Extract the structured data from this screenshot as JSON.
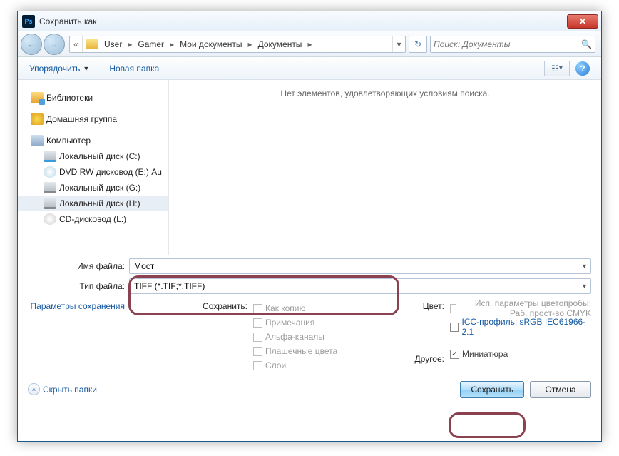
{
  "titlebar": {
    "title": "Сохранить как"
  },
  "breadcrumb": {
    "chevrons": "«",
    "segs": [
      "User",
      "Gamer",
      "Мои документы",
      "Документы"
    ]
  },
  "search": {
    "placeholder": "Поиск: Документы"
  },
  "toolbar": {
    "organize": "Упорядочить",
    "new_folder": "Новая папка"
  },
  "sidebar": {
    "libraries": "Библиотеки",
    "homegroup": "Домашняя группа",
    "computer": "Компьютер",
    "drives": [
      "Локальный диск (C:)",
      "DVD RW дисковод (E:) Au",
      "Локальный диск (G:)",
      "Локальный диск (H:)",
      "CD-дисковод (L:)"
    ]
  },
  "content": {
    "empty": "Нет элементов, удовлетворяющих условиям поиска."
  },
  "filename": {
    "label": "Имя файла:",
    "value": "Мост"
  },
  "filetype": {
    "label": "Тип файла:",
    "value": "TIFF (*.TIF;*.TIFF)"
  },
  "save_params_link": "Параметры сохранения",
  "save_opts": {
    "header": "Сохранить:",
    "as_copy": "Как копию",
    "notes": "Примечания",
    "alpha": "Альфа-каналы",
    "spot": "Плашечные цвета",
    "layers": "Слои"
  },
  "color_opts": {
    "header": "Цвет:",
    "proof": "Исп. параметры цветопробы:   Раб. прост-во CMYK",
    "icc": "ICC-профиль: sRGB IEC61966-2.1"
  },
  "other_opts": {
    "header": "Другое:",
    "thumb": "Миниатюра"
  },
  "footer": {
    "hide": "Скрыть папки",
    "save": "Сохранить",
    "cancel": "Отмена"
  }
}
